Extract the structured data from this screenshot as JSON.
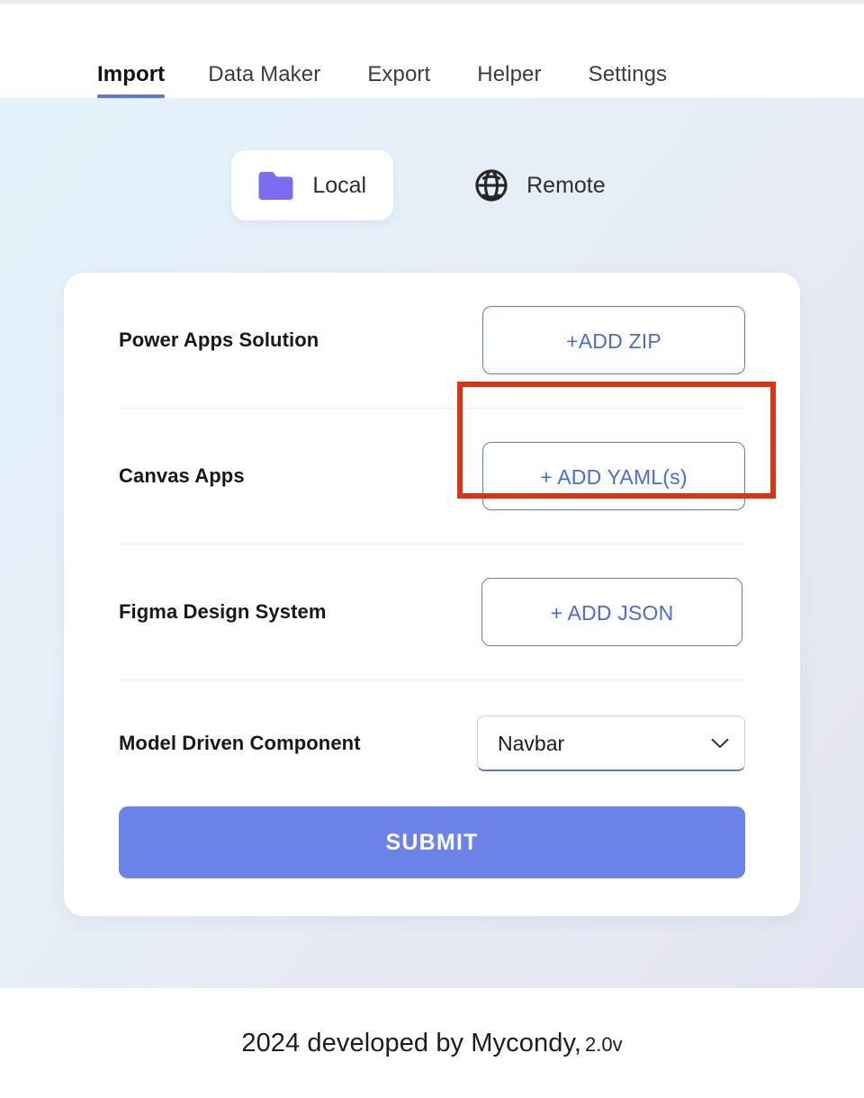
{
  "nav": {
    "tabs": [
      {
        "label": "Import",
        "active": true
      },
      {
        "label": "Data Maker",
        "active": false
      },
      {
        "label": "Export",
        "active": false
      },
      {
        "label": "Helper",
        "active": false
      },
      {
        "label": "Settings",
        "active": false
      }
    ],
    "active_underline_color": "#5a78e0"
  },
  "source_selector": {
    "options": [
      {
        "label": "Local",
        "icon": "folder-icon",
        "selected": true
      },
      {
        "label": "Remote",
        "icon": "globe-icon",
        "selected": false
      }
    ],
    "folder_icon_color": "#7b6cf0",
    "globe_icon_color": "#262628"
  },
  "import_form": {
    "rows": [
      {
        "label": "Power Apps Solution",
        "action": "+ADD ZIP",
        "control": "button"
      },
      {
        "label": "Canvas Apps",
        "action": "+ ADD YAML(s)",
        "control": "button"
      },
      {
        "label": "Figma Design System",
        "action": "+ ADD JSON",
        "control": "button"
      }
    ],
    "model_driven": {
      "label": "Model Driven Component",
      "selected_value": "Navbar",
      "options": [
        "Navbar"
      ]
    },
    "submit_label": "SUBMIT",
    "submit_color": "#6b82e8",
    "outline_button_color": "#4a6ae2"
  },
  "annotation": {
    "target": "+ADD ZIP",
    "color": "#dc3412"
  },
  "footer": {
    "text": "2024 developed by Mycondy,",
    "version": "2.0v"
  }
}
